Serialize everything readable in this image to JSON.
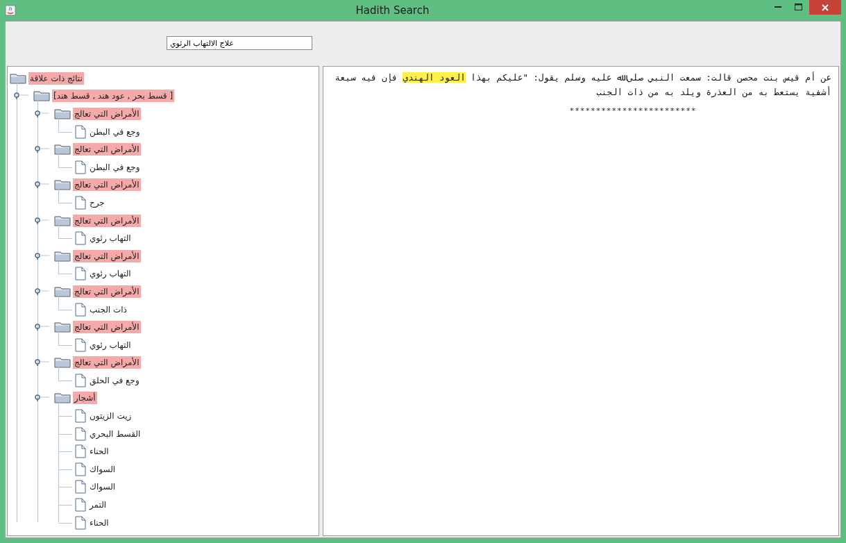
{
  "window": {
    "title": "Hadith Search"
  },
  "search": {
    "value": "علاج الالتهاب الرئوي"
  },
  "tree": {
    "label": "نتائج ذات علاقة",
    "highlighted": true,
    "children": [
      {
        "label": "[قسط بحر , عود هند , قسط هند ]",
        "highlighted": true,
        "expanded": true,
        "children": [
          {
            "label": "الأمراض التي تعالج",
            "highlighted": true,
            "expanded": true,
            "children": [
              {
                "label": "وجع في البطن",
                "highlighted": false
              }
            ]
          },
          {
            "label": "الأمراض التي تعالج",
            "highlighted": true,
            "expanded": true,
            "children": [
              {
                "label": "وجع في البطن",
                "highlighted": false
              }
            ]
          },
          {
            "label": "الأمراض التي تعالج",
            "highlighted": true,
            "expanded": true,
            "children": [
              {
                "label": "جرح",
                "highlighted": false
              }
            ]
          },
          {
            "label": "الأمراض التي تعالج",
            "highlighted": true,
            "expanded": true,
            "children": [
              {
                "label": "التهاب رئوي",
                "highlighted": false
              }
            ]
          },
          {
            "label": "الأمراض التي تعالج",
            "highlighted": true,
            "expanded": true,
            "children": [
              {
                "label": "التهاب رئوي",
                "highlighted": false
              }
            ]
          },
          {
            "label": "الأمراض التي تعالج",
            "highlighted": true,
            "expanded": true,
            "children": [
              {
                "label": "ذات الجنب",
                "highlighted": false
              }
            ]
          },
          {
            "label": "الأمراض التي تعالج",
            "highlighted": true,
            "expanded": true,
            "children": [
              {
                "label": "التهاب رئوي",
                "highlighted": false
              }
            ]
          },
          {
            "label": "الأمراض التي تعالج",
            "highlighted": true,
            "expanded": true,
            "children": [
              {
                "label": "وجع في الحلق",
                "highlighted": false
              }
            ]
          },
          {
            "label": "أشجار",
            "highlighted": true,
            "expanded": true,
            "children": [
              {
                "label": "زيت الزيتون",
                "highlighted": false
              },
              {
                "label": "القسط البحري",
                "highlighted": false
              },
              {
                "label": "الحناء",
                "highlighted": false
              },
              {
                "label": "السواك",
                "highlighted": false
              },
              {
                "label": "السواك",
                "highlighted": false
              },
              {
                "label": "التمر",
                "highlighted": false
              },
              {
                "label": "الحناء",
                "highlighted": false
              }
            ]
          }
        ]
      }
    ]
  },
  "document": {
    "segments": [
      {
        "text": "عن أم قيس بنت محصن قالت: سمعت النبي صلى ﷲ عليه وسلم يقول: \"عليكم بهذا ",
        "highlighted": false
      },
      {
        "text": "العود الهندي",
        "highlighted": true
      },
      {
        "text": " فإن فيه سبعة أشفية يستعط به من العذرة ويلد به من ذات الجنب",
        "highlighted": false
      }
    ],
    "separator": "************************"
  }
}
